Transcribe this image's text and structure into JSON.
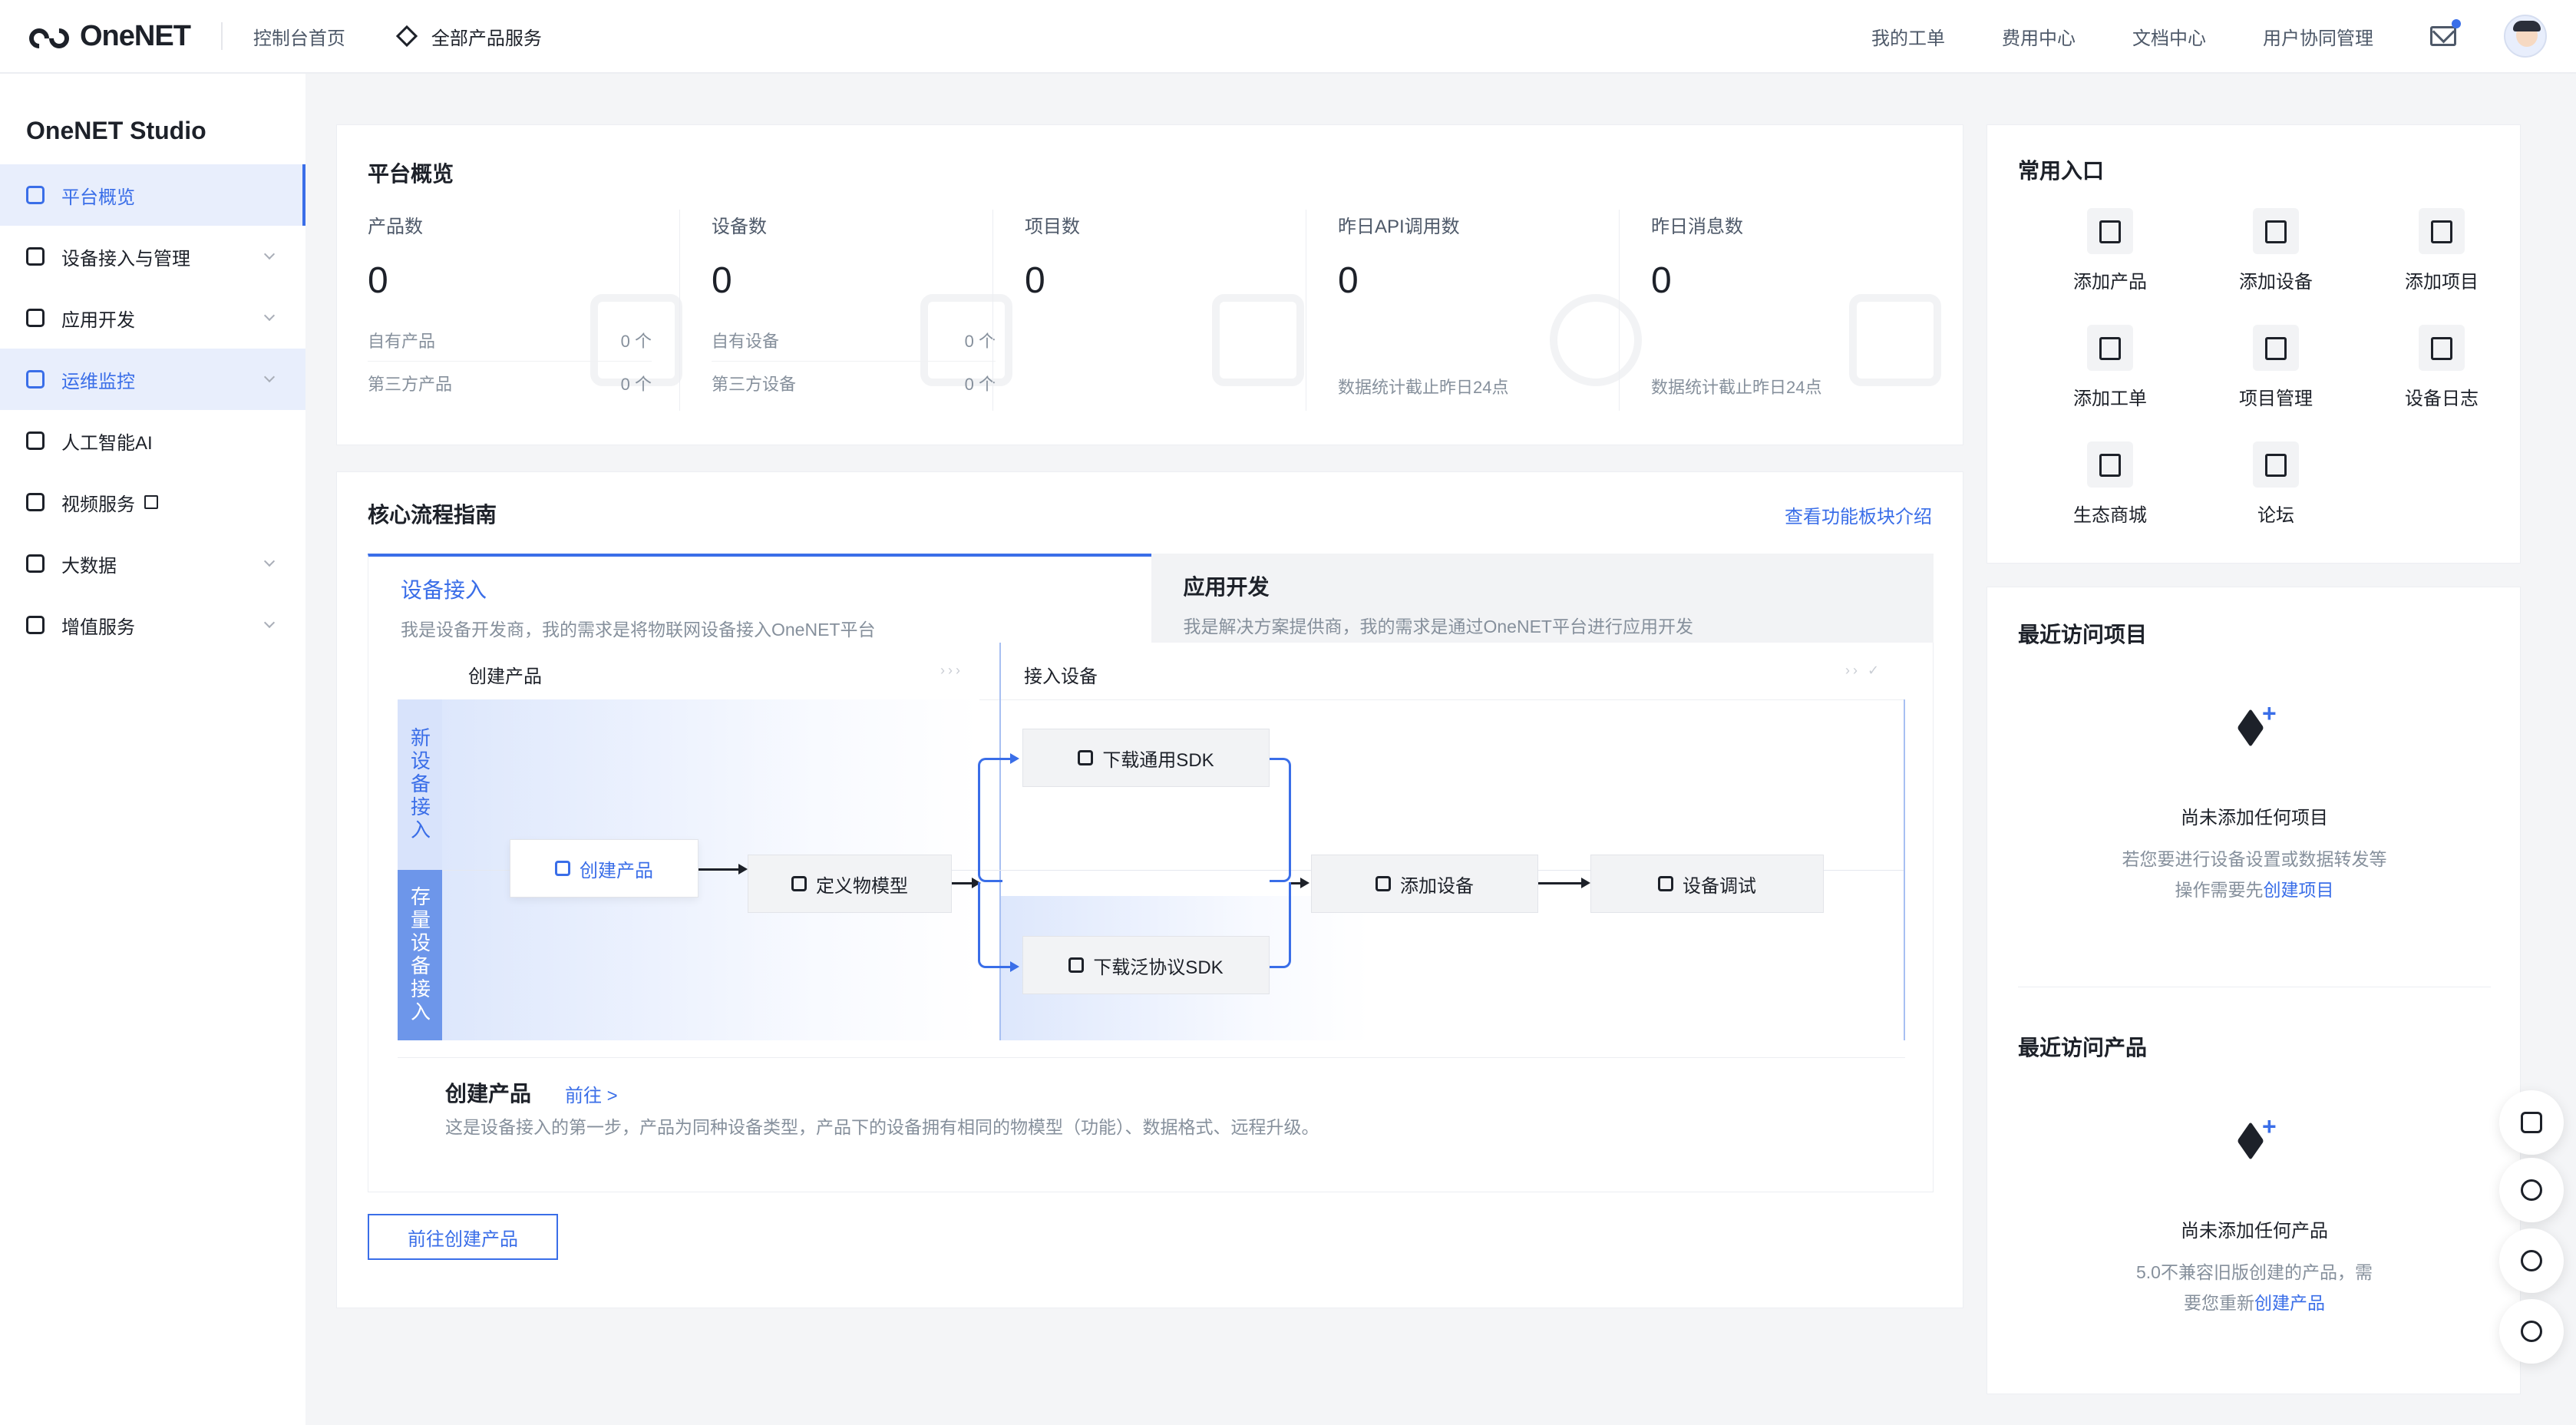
{
  "header": {
    "logo_text": "OneNET",
    "console_home": "控制台首页",
    "all_products": "全部产品服务",
    "nav": [
      "我的工单",
      "费用中心",
      "文档中心",
      "用户协同管理"
    ]
  },
  "sidebar": {
    "title": "OneNET Studio",
    "items": [
      {
        "label": "平台概览",
        "icon": "overview-icon",
        "state": "active"
      },
      {
        "label": "设备接入与管理",
        "icon": "device-icon",
        "chevron": true
      },
      {
        "label": "应用开发",
        "icon": "cube-icon",
        "chevron": true
      },
      {
        "label": "运维监控",
        "icon": "monitor-icon",
        "chevron": true,
        "state": "open"
      },
      {
        "label": "人工智能AI",
        "icon": "ai-link-icon"
      },
      {
        "label": "视频服务",
        "icon": "video-icon",
        "external": true
      },
      {
        "label": "大数据",
        "icon": "bigdata-icon",
        "chevron": true
      },
      {
        "label": "增值服务",
        "icon": "rocket-icon",
        "chevron": true
      }
    ]
  },
  "overview": {
    "title": "平台概览",
    "stats": [
      {
        "label": "产品数",
        "value": "0",
        "subs": [
          {
            "label": "自有产品",
            "value": "0 个"
          },
          {
            "label": "第三方产品",
            "value": "0 个"
          }
        ]
      },
      {
        "label": "设备数",
        "value": "0",
        "subs": [
          {
            "label": "自有设备",
            "value": "0 个"
          },
          {
            "label": "第三方设备",
            "value": "0 个"
          }
        ]
      },
      {
        "label": "项目数",
        "value": "0"
      },
      {
        "label": "昨日API调用数",
        "value": "0",
        "note": "数据统计截止昨日24点"
      },
      {
        "label": "昨日消息数",
        "value": "0",
        "note": "数据统计截止昨日24点"
      }
    ]
  },
  "guide": {
    "title": "核心流程指南",
    "link": "查看功能板块介绍",
    "tabs": [
      {
        "title": "设备接入",
        "desc": "我是设备开发商，我的需求是将物联网设备接入OneNET平台"
      },
      {
        "title": "应用开发",
        "desc": "我是解决方案提供商，我的需求是通过OneNET平台进行应用开发"
      }
    ],
    "columns": [
      "创建产品",
      "接入设备"
    ],
    "lanes": [
      "新设备接入",
      "存量设备接入"
    ],
    "nodes": {
      "create_product": "创建产品",
      "define_model": "定义物模型",
      "download_sdk": "下载通用SDK",
      "download_generic_sdk": "下载泛协议SDK",
      "add_device": "添加设备",
      "debug_device": "设备调试"
    },
    "detail": {
      "title": "创建产品",
      "link": "前往 >",
      "desc": "这是设备接入的第一步，产品为同种设备类型，产品下的设备拥有相同的物模型（功能）、数据格式、远程升级。"
    },
    "button": "前往创建产品"
  },
  "quick_entry": {
    "title": "常用入口",
    "items": [
      "添加产品",
      "添加设备",
      "添加项目",
      "添加工单",
      "项目管理",
      "设备日志",
      "生态商城",
      "论坛"
    ]
  },
  "recent_projects": {
    "title": "最近访问项目",
    "empty_title": "尚未添加任何项目",
    "empty_desc_1": "若您要进行设备设置或数据转发等",
    "empty_desc_2": "操作需要先",
    "empty_link": "创建项目"
  },
  "recent_products": {
    "title": "最近访问产品",
    "empty_title": "尚未添加任何产品",
    "empty_desc_1": "5.0不兼容旧版创建的产品，需",
    "empty_desc_2": "要您重新",
    "empty_link": "创建产品"
  },
  "colors": {
    "accent": "#3a6ee8",
    "text": "#1d2129",
    "muted": "#86909c",
    "bg": "#f4f5f7"
  }
}
